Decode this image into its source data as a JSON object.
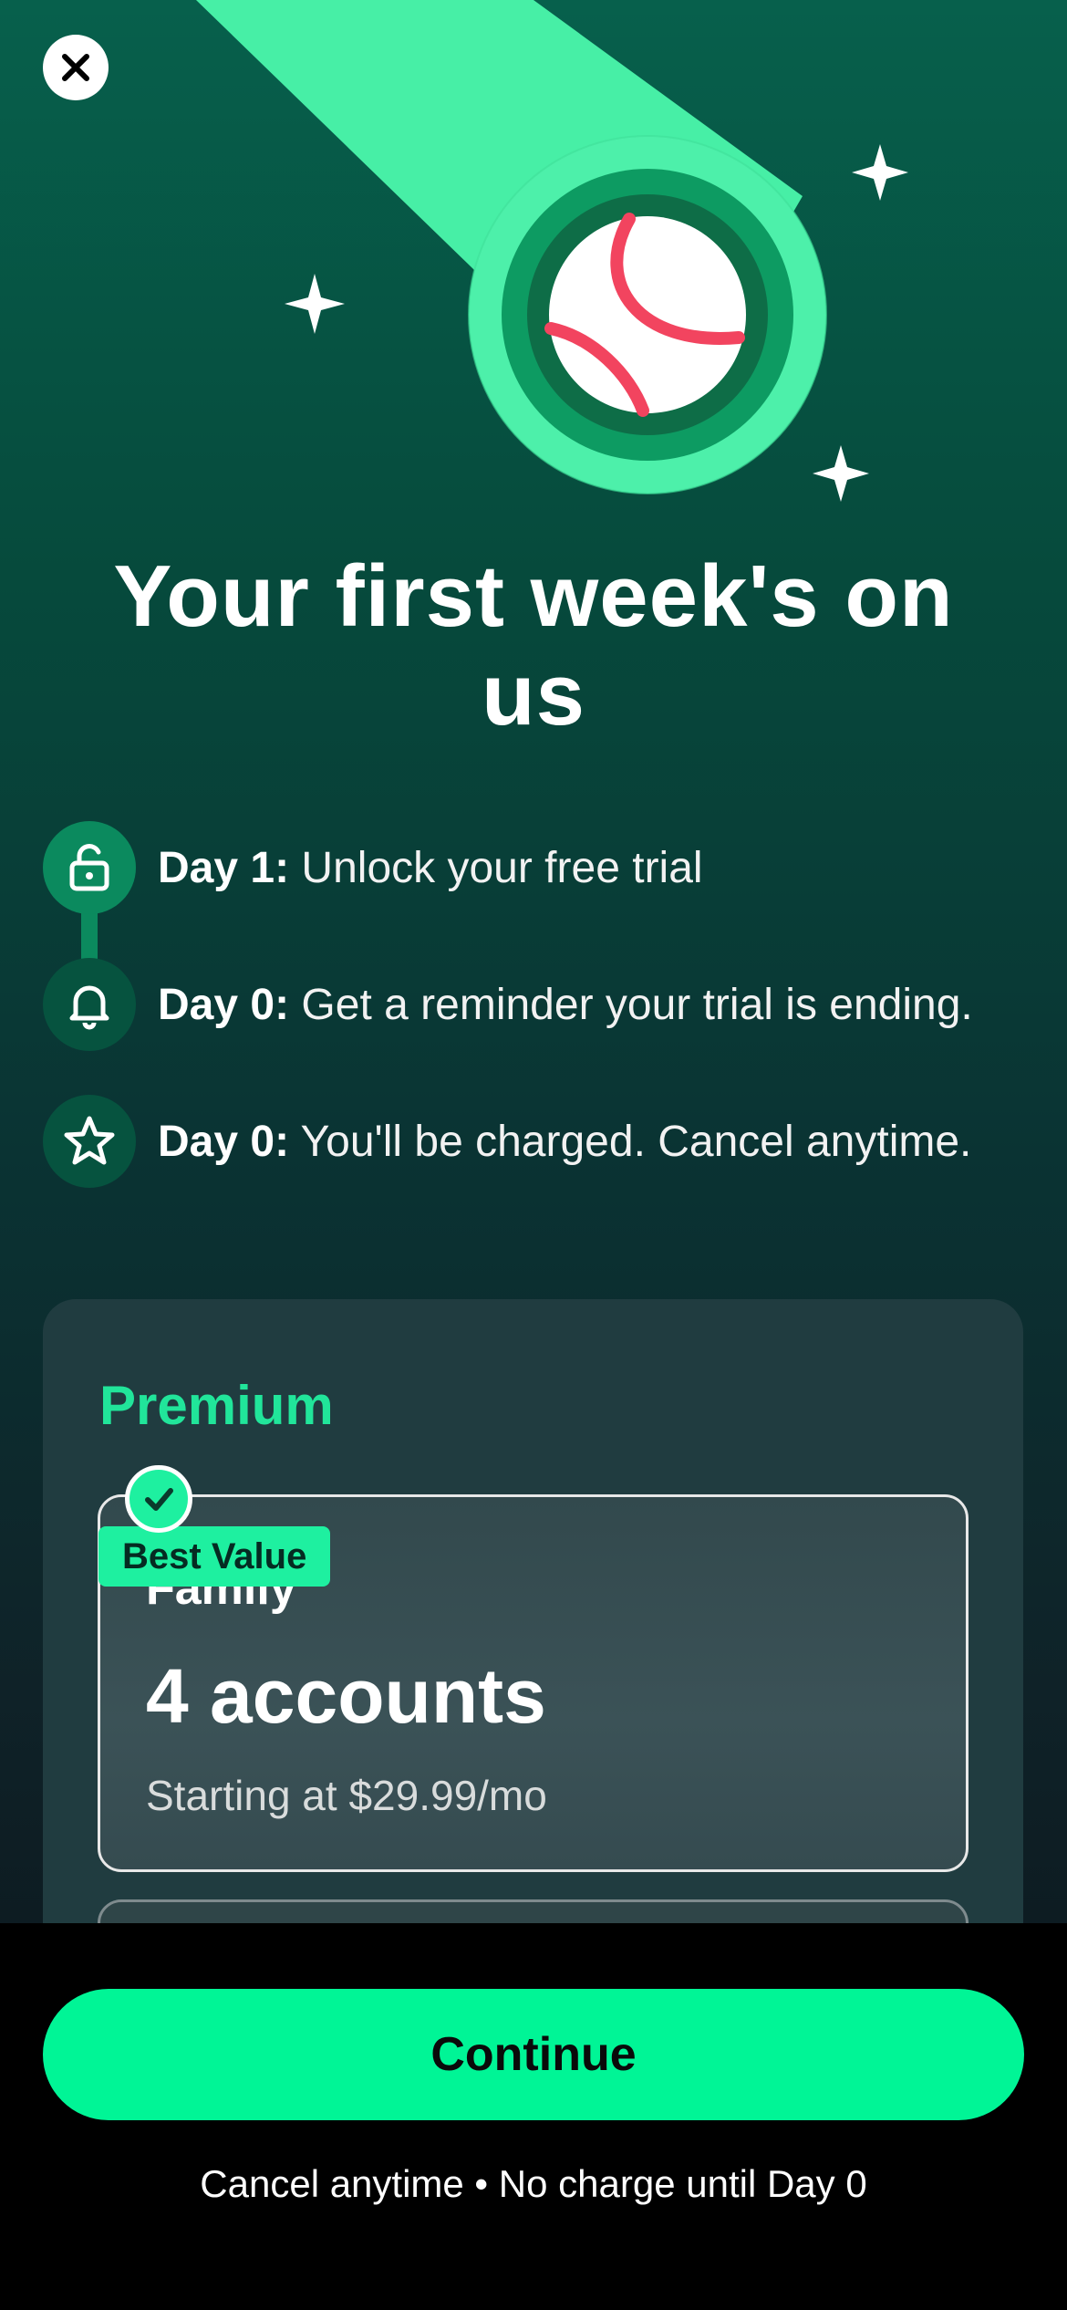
{
  "icons": {
    "close": "close-icon",
    "unlock": "unlock-icon",
    "bell": "bell-icon",
    "star": "star-icon",
    "check": "checkmark-icon",
    "hero": "baseball-comet-illustration"
  },
  "colors": {
    "accent": "#00F596",
    "title_green": "#21E59A",
    "bg_top": "#07604C",
    "bg_bottom": "#0D1C22",
    "card": "#203C40"
  },
  "title": "Your first week's on us",
  "timeline": [
    {
      "day": "Day 1:",
      "text": " Unlock your free trial",
      "icon": "unlock-icon"
    },
    {
      "day": "Day 0:",
      "text": " Get a reminder your trial is ending.",
      "icon": "bell-icon"
    },
    {
      "day": "Day 0:",
      "text": " You'll be charged. Cancel anytime.",
      "icon": "star-icon"
    }
  ],
  "plan_section": {
    "label": "Premium",
    "selected_plan": {
      "badge": "Best Value",
      "name": "Family",
      "accounts": "4 accounts",
      "price": "Starting at $29.99/mo"
    }
  },
  "footer": {
    "continue_label": "Continue",
    "footnote": "Cancel anytime • No charge until Day 0"
  }
}
